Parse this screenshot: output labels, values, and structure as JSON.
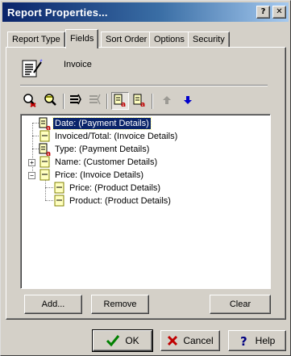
{
  "window": {
    "title": "Report Properties...",
    "help_glyph": "?",
    "close_glyph": "✕"
  },
  "tabs": [
    {
      "label": "Report Type",
      "active": false
    },
    {
      "label": "Fields",
      "active": true
    },
    {
      "label": "Sort Order",
      "active": false
    },
    {
      "label": "Options",
      "active": false
    },
    {
      "label": "Security",
      "active": false
    }
  ],
  "report": {
    "name": "Invoice",
    "icon": "report-document-icon"
  },
  "toolbar": {
    "buttons": [
      {
        "name": "find-field-icon",
        "enabled": true,
        "pressed": false
      },
      {
        "name": "find-next-icon",
        "enabled": true,
        "pressed": false
      },
      {
        "name": "expand-all-icon",
        "enabled": true,
        "pressed": false
      },
      {
        "name": "collapse-all-icon",
        "enabled": false,
        "pressed": false
      },
      {
        "name": "sort-field-icon",
        "enabled": true,
        "pressed": true
      },
      {
        "name": "sort-field-alt-icon",
        "enabled": true,
        "pressed": false
      },
      {
        "name": "move-up-icon",
        "enabled": false,
        "pressed": false
      },
      {
        "name": "move-down-icon",
        "enabled": true,
        "pressed": false
      }
    ]
  },
  "tree": {
    "items": [
      {
        "label": "Date: (Payment Details)",
        "icon": "sort-field-icon",
        "selected": true,
        "expander": ""
      },
      {
        "label": "Invoiced/Total: (Invoice Details)",
        "icon": "field-icon",
        "selected": false,
        "expander": ""
      },
      {
        "label": "Type: (Payment Details)",
        "icon": "sort-field-icon",
        "selected": false,
        "expander": ""
      },
      {
        "label": "Name: (Customer Details)",
        "icon": "field-icon",
        "selected": false,
        "expander": "+"
      },
      {
        "label": "Price: (Invoice Details)",
        "icon": "field-icon",
        "selected": false,
        "expander": "−"
      },
      {
        "label": "Price: (Product Details)",
        "icon": "field-icon",
        "selected": false,
        "expander": ""
      },
      {
        "label": "Product: (Product Details)",
        "icon": "field-icon",
        "selected": false,
        "expander": ""
      }
    ]
  },
  "actions": {
    "add": "Add...",
    "remove": "Remove",
    "clear": "Clear"
  },
  "footer": {
    "ok": "OK",
    "cancel": "Cancel",
    "help": "Help"
  },
  "colors": {
    "title_start": "#0a246a",
    "title_end": "#a6caf0",
    "selection": "#0a246a",
    "face": "#d4d0c8"
  }
}
